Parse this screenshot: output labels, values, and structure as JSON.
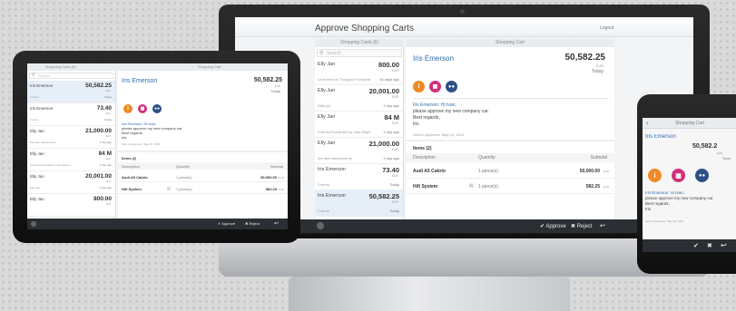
{
  "monitor": {
    "title": "Approve Shopping Carts",
    "logout": "Logout",
    "list_header": "Shopping Carts (6)",
    "detail_header": "Shopping Cart",
    "search_placeholder": "Search",
    "list_items": [
      {
        "name": "Elly Jan",
        "amount": "800.00",
        "currency": "EUR",
        "note": "Limit item for Transport Forwarded by Ivan Rispin",
        "time": "16 days ago"
      },
      {
        "name": "Elly Jan",
        "amount": "20,001.00",
        "currency": "EUR",
        "note": "Sale job",
        "time": "1 day ago"
      },
      {
        "name": "Elly Jan",
        "amount": "84 M",
        "currency": "EUR",
        "note": "3 items Forwarded by Ivan Rispin",
        "time": "1 day ago"
      },
      {
        "name": "Elly Jan",
        "amount": "21,000.00",
        "currency": "EUR",
        "note": "We alert attachments",
        "time": "1 day ago"
      },
      {
        "name": "Iris Emerson",
        "amount": "73.40",
        "currency": "EUR",
        "note": "3 items",
        "time": "Today"
      },
      {
        "name": "Iris Emerson",
        "amount": "50,582.25",
        "currency": "EUR",
        "note": "2 items",
        "time": "Today"
      }
    ],
    "detail": {
      "name": "Iris Emerson",
      "amount": "50,582.25",
      "currency": "EUR",
      "date": "Today",
      "message_lines": [
        "Iris Emerson: Hi Ivan,",
        "please approve my new company car.",
        "Best regards,",
        "Iris"
      ],
      "meta": "Sent to Approver: May 10, 2013",
      "items_title": "Items (2)",
      "columns": [
        "Description",
        "Quantity",
        "Subtotal"
      ],
      "rows": [
        {
          "description": "Audi A5 Cabrio",
          "quantity": "1 piece(s)",
          "subtotal": "50,000.00",
          "currency": "EUR"
        },
        {
          "description": "Hifi System",
          "quantity": "1 piece(s)",
          "subtotal": "582.25",
          "currency": "EUR"
        }
      ]
    },
    "toolbar": {
      "approve": "Approve",
      "reject": "Reject"
    }
  },
  "tablet": {
    "list_header": "Shopping Carts (6)",
    "detail_header": "Shopping Cart",
    "search_placeholder": "Search",
    "list_items": [
      {
        "name": "Iris Emerson",
        "amount": "50,582.25",
        "currency": "EUR",
        "note": "2 items",
        "time": "Today"
      },
      {
        "name": "Iris Emerson",
        "amount": "73.40",
        "currency": "EUR",
        "note": "3 items",
        "time": "Today"
      },
      {
        "name": "Elly Jan",
        "amount": "21,000.00",
        "currency": "EUR",
        "note": "We alert attachments",
        "time": "1 day ago"
      },
      {
        "name": "Elly Jan",
        "amount": "84 M",
        "currency": "EUR",
        "note": "3 items Forwarded by Ivan Rispin",
        "time": "1 day ago"
      },
      {
        "name": "Elly Jan",
        "amount": "20,001.00",
        "currency": "EUR",
        "note": "Sale job",
        "time": "1 day ago"
      },
      {
        "name": "Elly Jan",
        "amount": "800.00",
        "currency": "EUR",
        "note": "",
        "time": ""
      }
    ],
    "detail": {
      "name": "Iris Emerson",
      "amount": "50,582.25",
      "currency": "EUR",
      "date": "Today",
      "message_lines": [
        "Iris Emerson: Hi Ivan,",
        "please approve my new company car.",
        "Best regards,",
        "Iris"
      ],
      "meta": "Sent to Approver: May 10, 2013",
      "items_title": "Items (2)",
      "columns": [
        "Description",
        "Quantity",
        "Subtotal"
      ],
      "rows": [
        {
          "description": "Audi A5 Cabrio",
          "quantity": "1 piece(s)",
          "subtotal": "50,000.00",
          "currency": "EUR"
        },
        {
          "description": "Hifi System",
          "quantity": "1 piece(s)",
          "subtotal": "582.25",
          "currency": "EUR"
        }
      ]
    },
    "toolbar": {
      "approve": "Approve",
      "reject": "Reject"
    }
  },
  "phone": {
    "header": "Shopping Cart",
    "name": "Iris Emerson",
    "amount": "50,582.2",
    "currency": "EUR",
    "date": "Toda",
    "message_lines": [
      "Iris Emerson: Hi Ivan,",
      "please approve my new company car.",
      "Best regards,",
      "Iris"
    ],
    "meta": "Sent to Approver: May 10, 2013"
  },
  "icons": {
    "info": "info-icon",
    "calendar": "calendar-icon",
    "people": "people-icon",
    "approve": "checkmark-icon",
    "reject": "x-icon",
    "forward": "forward-icon"
  },
  "colors": {
    "accent": "#2f6db0",
    "orange": "#f08a23",
    "pink": "#d2307a",
    "navy": "#2c4f86",
    "toolbar": "#2b2f33"
  }
}
